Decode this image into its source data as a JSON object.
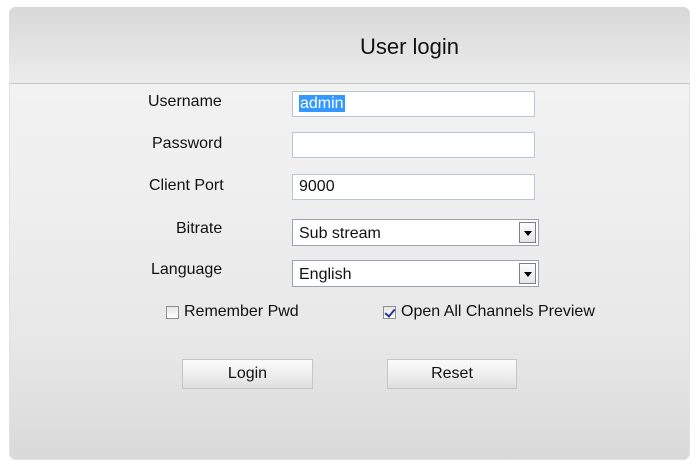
{
  "dialog": {
    "title": "User login"
  },
  "form": {
    "username": {
      "label": "Username",
      "value": "admin"
    },
    "password": {
      "label": "Password",
      "value": ""
    },
    "client_port": {
      "label": "Client Port",
      "value": "9000"
    },
    "bitrate": {
      "label": "Bitrate",
      "selected": "Sub stream"
    },
    "language": {
      "label": "Language",
      "selected": "English"
    }
  },
  "options": {
    "remember_pwd": {
      "label": "Remember Pwd",
      "checked": false
    },
    "open_all_channels": {
      "label": "Open All Channels Preview",
      "checked": true
    }
  },
  "buttons": {
    "login": "Login",
    "reset": "Reset"
  }
}
